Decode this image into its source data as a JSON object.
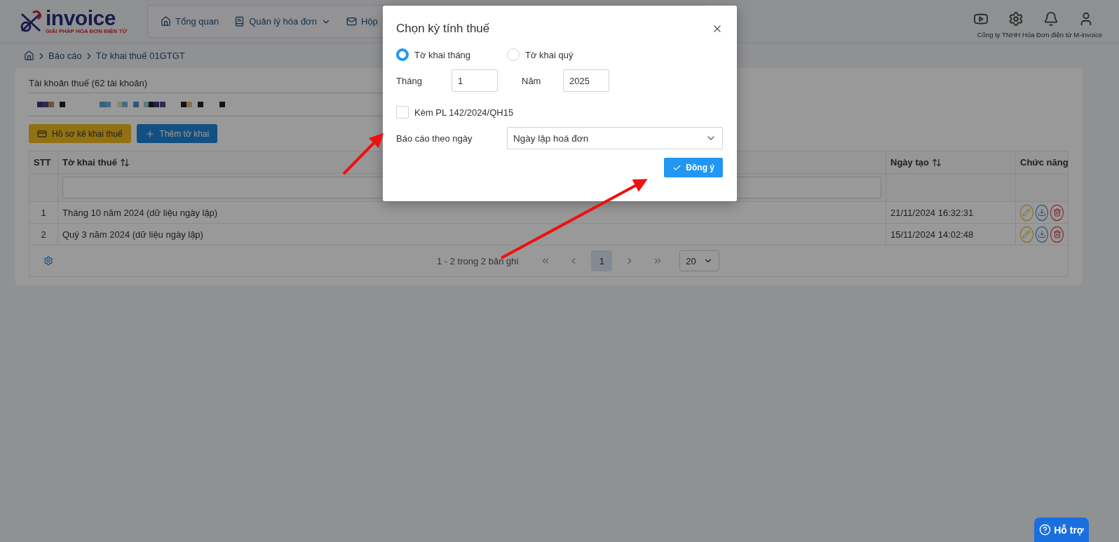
{
  "header": {
    "logo": {
      "name": "invoice",
      "tagline": "GIẢI PHÁP HÓA ĐƠN ĐIỆN TỬ"
    },
    "nav": [
      {
        "label": "Tổng quan",
        "dropdown": false
      },
      {
        "label": "Quản lý hóa đơn",
        "dropdown": true
      },
      {
        "label": "Hộp",
        "dropdown": false
      }
    ],
    "company": "Công ty TNHH Hóa Đơn điện tử M-invoice"
  },
  "breadcrumb": [
    "Báo cáo",
    "Tờ khai thuế 01GTGT"
  ],
  "account": {
    "label": "Tài khoản thuế (62 tài khoản)"
  },
  "actions": [
    {
      "label": "Hồ sơ kê khai thuế",
      "kind": "profile"
    },
    {
      "label": "Thêm tờ khai",
      "kind": "add"
    }
  ],
  "table": {
    "columns": [
      {
        "label": "STT",
        "sortable": false
      },
      {
        "label": "Tờ khai thuế",
        "sortable": true
      },
      {
        "label": "Ngày tạo",
        "sortable": true
      },
      {
        "label": "Chức năng",
        "sortable": false
      }
    ],
    "rows": [
      {
        "stt": "1",
        "name": "Tháng 10 năm 2024 (dữ liệu ngày lập)",
        "created": "21/11/2024 16:32:31"
      },
      {
        "stt": "2",
        "name": "Quý 3 năm 2024 (dữ liệu ngày lập)",
        "created": "15/11/2024 14:02:48"
      }
    ],
    "pagination": {
      "summary": "1 - 2 trong 2 bản ghi",
      "pages": [
        {
          "label": "1",
          "selected": true
        }
      ],
      "page_size": "20"
    }
  },
  "modal": {
    "title": "Chọn kỳ tính thuế",
    "radios": [
      {
        "label": "Tờ khai tháng",
        "selected": true
      },
      {
        "label": "Tờ khai quý",
        "selected": false
      }
    ],
    "month": {
      "label": "Tháng",
      "value": "1"
    },
    "year": {
      "label": "Năm",
      "value": "2025"
    },
    "checkbox": {
      "label": "Kèm PL 142/2024/QH15",
      "checked": false
    },
    "report_by": {
      "label": "Báo cáo theo ngày",
      "value": "Ngày lập hoá đơn"
    },
    "confirm": "Đồng ý"
  },
  "help": "Hỗ trợ"
}
